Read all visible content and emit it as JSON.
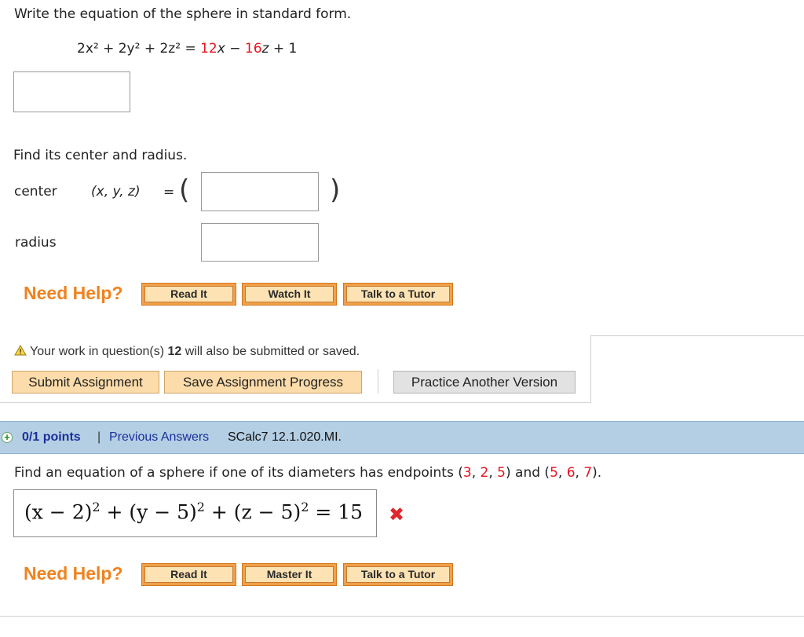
{
  "q1": {
    "prompt": "Write the equation of the sphere in standard form.",
    "eq_lhs": "2x² + 2y² + 2z² =",
    "eq_a": "12",
    "eq_x": "x",
    "eq_minus": "−",
    "eq_b": "16",
    "eq_z": "z",
    "eq_tail": "+ 1",
    "find_prompt": "Find its center and radius.",
    "center_label": "center",
    "center_vars": "(x, y, z)",
    "equals": "=",
    "paren_open": "(",
    "paren_close": ")",
    "radius_label": "radius"
  },
  "help1": {
    "label": "Need Help?",
    "read_it": "Read It",
    "watch_it": "Watch It",
    "talk_tutor": "Talk to a Tutor"
  },
  "submit_panel": {
    "warning_prefix": "Your work in question(s)",
    "warning_num": "12",
    "warning_suffix": "will also be submitted or saved.",
    "submit": "Submit Assignment",
    "save": "Save Assignment Progress",
    "practice": "Practice Another Version"
  },
  "q2_header": {
    "points": "0/1 points",
    "separator": "|",
    "previous": "Previous Answers",
    "code": "SCalc7 12.1.020.MI."
  },
  "q2": {
    "prompt": "Find an equation of a sphere if one of its diameters has endpoints",
    "p1_open": "(",
    "p1_a": "3",
    "p1_b": "2",
    "p1_c": "5",
    "p1_close": ")",
    "and": "and",
    "p2_open": "(",
    "p2_a": "5",
    "p2_b": "6",
    "p2_c": "7",
    "p2_close": ").",
    "answer_part1": "(x − 2)",
    "answer_part2": " + (y − 5)",
    "answer_part3": " + (z − 5)",
    "answer_exp": "2",
    "answer_tail": " = 15",
    "status": "incorrect"
  },
  "help2": {
    "label": "Need Help?",
    "read_it": "Read It",
    "master_it": "Master It",
    "talk_tutor": "Talk to a Tutor"
  },
  "colors": {
    "accent_red": "#e8141f",
    "help_orange": "#f0821e",
    "header_blue": "#b4cfe4",
    "link_blue": "#1b2f9a"
  },
  "icons": {
    "warning": "warning-triangle-icon",
    "expand": "plus-circle-icon",
    "incorrect": "red-x-icon"
  }
}
